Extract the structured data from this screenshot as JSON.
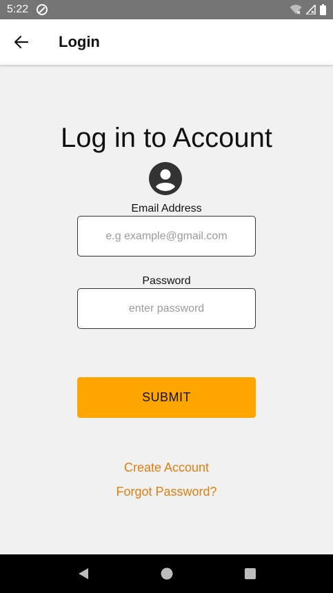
{
  "status_bar": {
    "time": "5:22",
    "icons": [
      "app-notification-icon",
      "wifi-icon",
      "signal-icon",
      "battery-icon"
    ]
  },
  "app_bar": {
    "back_icon": "arrow-left-icon",
    "title": "Login"
  },
  "form": {
    "heading": "Log in to Account",
    "avatar_icon": "account-circle-icon",
    "email": {
      "label": "Email Address",
      "placeholder": "e.g example@gmail.com",
      "value": ""
    },
    "password": {
      "label": "Password",
      "placeholder": "enter password",
      "value": ""
    },
    "submit_label": "SUBMIT",
    "create_account_label": "Create Account",
    "forgot_password_label": "Forgot Password?"
  },
  "nav_bar": {
    "icons": [
      "back-triangle-icon",
      "home-circle-icon",
      "recents-square-icon"
    ]
  },
  "colors": {
    "accent": "#ffa500",
    "link": "#e07e10",
    "background": "#f1f1f1",
    "status_bar": "#757575"
  }
}
